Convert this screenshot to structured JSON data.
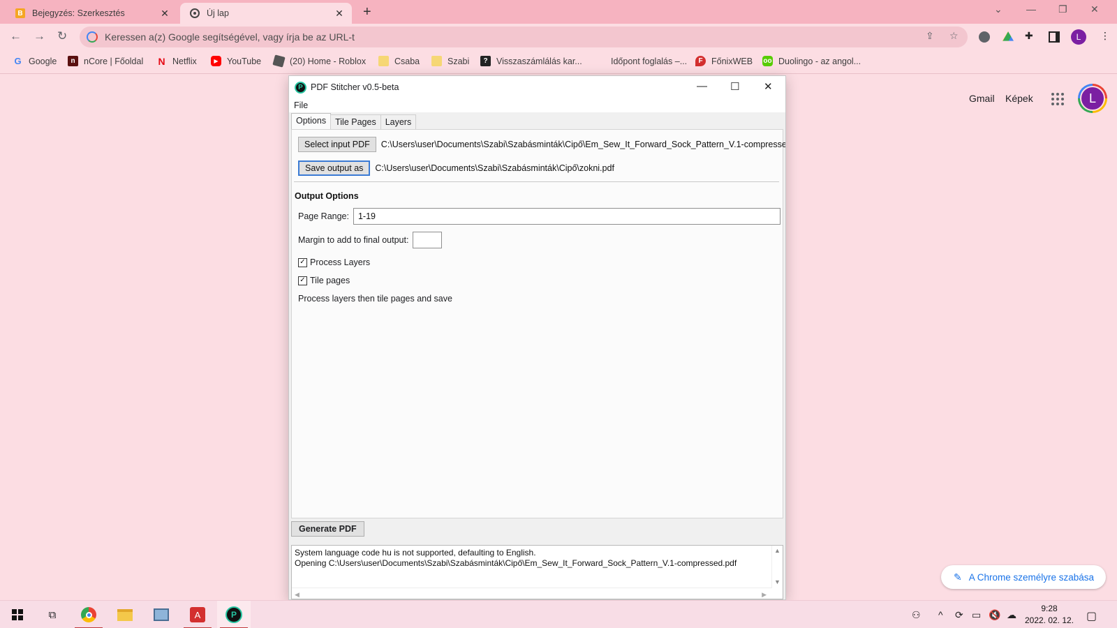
{
  "browser": {
    "tabs": [
      {
        "title": "Bejegyzés: Szerkesztés",
        "active": false
      },
      {
        "title": "Új lap",
        "active": true
      }
    ],
    "new_tab_symbol": "+",
    "close_symbol": "✕",
    "omnibox_placeholder": "Keressen a(z) Google segítségével, vagy írja be az URL-t",
    "profile_initial": "L",
    "bookmarks": [
      {
        "label": "Google",
        "icon": "google-icon",
        "color": "#4285f4"
      },
      {
        "label": "nCore | Főoldal",
        "icon": "ncore-icon",
        "color": "#5a1010"
      },
      {
        "label": "Netflix",
        "icon": "netflix-icon",
        "color": "#e50914"
      },
      {
        "label": "YouTube",
        "icon": "youtube-icon",
        "color": "#ff0000"
      },
      {
        "label": "(20) Home - Roblox",
        "icon": "roblox-icon",
        "color": "#555555"
      },
      {
        "label": "Csaba",
        "icon": "folder-icon",
        "color": "#f6d775"
      },
      {
        "label": "Szabi",
        "icon": "folder-icon",
        "color": "#f6d775"
      },
      {
        "label": "Visszaszámlálás kar...",
        "icon": "question-icon",
        "color": "#222222"
      },
      {
        "label": "Időpont foglalás –...",
        "icon": "blank-icon",
        "color": "#fcdde3"
      },
      {
        "label": "FőnixWEB",
        "icon": "fonix-icon",
        "color": "#d32f2f"
      },
      {
        "label": "Duolingo - az angol...",
        "icon": "duolingo-icon",
        "color": "#58cc02"
      }
    ]
  },
  "ntp": {
    "links": [
      "Gmail",
      "Képek"
    ],
    "avatar_initial": "L",
    "customize_label": "A Chrome személyre szabása"
  },
  "app": {
    "title": "PDF Stitcher v0.5-beta",
    "menu": [
      "File"
    ],
    "tabs": [
      "Options",
      "Tile Pages",
      "Layers"
    ],
    "select_input_label": "Select input PDF",
    "input_path": "C:\\Users\\user\\Documents\\Szabi\\Szabásminták\\Cipő\\Em_Sew_It_Forward_Sock_Pattern_V.1-compressed.p",
    "save_output_label": "Save output as",
    "output_path": "C:\\Users\\user\\Documents\\Szabi\\Szabásminták\\Cipő\\zokni.pdf",
    "section_title": "Output Options",
    "page_range_label": "Page Range:",
    "page_range_value": "1-19",
    "margin_label": "Margin to add to final output:",
    "margin_value": "",
    "process_layers_label": "Process Layers",
    "process_layers_checked": true,
    "tile_pages_label": "Tile pages",
    "tile_pages_checked": true,
    "action_text": "Process layers then tile pages and save",
    "generate_label": "Generate PDF",
    "log_lines": [
      "System language code hu is not supported, defaulting to English.",
      "Opening C:\\Users\\user\\Documents\\Szabi\\Szabásminták\\Cipő\\Em_Sew_It_Forward_Sock_Pattern_V.1-compressed.pdf"
    ],
    "checkmark": "✓"
  },
  "taskbar": {
    "time": "9:28",
    "date": "2022. 02. 12.",
    "apps": [
      "start-icon",
      "task-view-icon",
      "chrome-icon",
      "file-explorer-icon",
      "network-icon",
      "acrobat-icon",
      "pdf-stitcher-icon"
    ]
  }
}
